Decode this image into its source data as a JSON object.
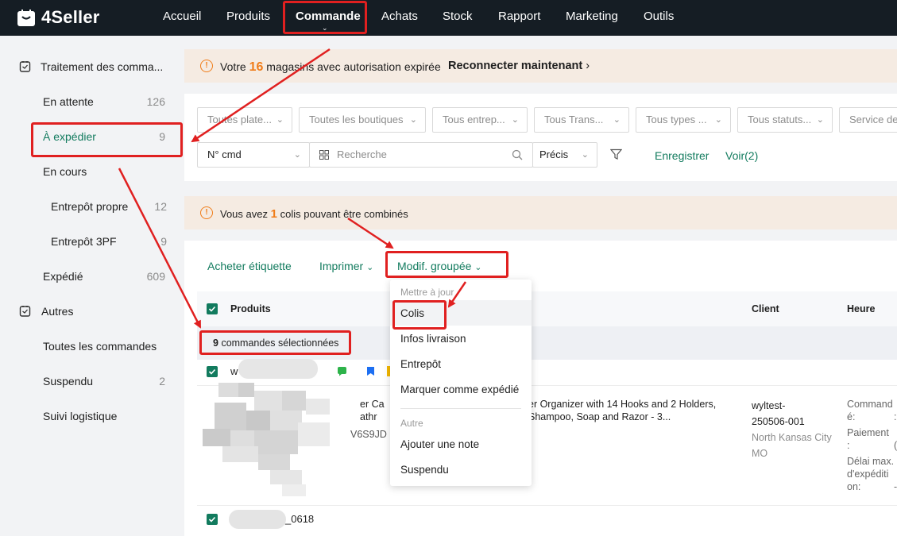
{
  "app": {
    "name": "4Seller"
  },
  "nav": {
    "items": [
      "Accueil",
      "Produits",
      "Commande",
      "Achats",
      "Stock",
      "Rapport",
      "Marketing",
      "Outils"
    ],
    "active": "Commande"
  },
  "sidebar": {
    "group1": "Traitement des comma...",
    "items": [
      {
        "label": "En attente",
        "count": "126"
      },
      {
        "label": "À expédier",
        "count": "9"
      },
      {
        "label": "En cours",
        "count": ""
      },
      {
        "label": "Entrepôt propre",
        "count": "12"
      },
      {
        "label": "Entrepôt 3PF",
        "count": "9"
      },
      {
        "label": "Expédié",
        "count": "609"
      }
    ],
    "group2": "Autres",
    "others": [
      {
        "label": "Toutes les commandes",
        "count": ""
      },
      {
        "label": "Suspendu",
        "count": "2"
      },
      {
        "label": "Suivi logistique",
        "count": ""
      }
    ]
  },
  "notice1": {
    "prefix": "Votre",
    "number": "16",
    "suffix": "magasins avec autorisation expirée",
    "action": "Reconnecter maintenant"
  },
  "filters": {
    "selects": [
      "Toutes plate...",
      "Toutes les boutiques",
      "Tous entrep...",
      "Tous Trans...",
      "Tous types ...",
      "Tous statuts...",
      "Service de"
    ],
    "search_type": "N° cmd",
    "search_placeholder": "Recherche",
    "match": "Précis",
    "save": "Enregistrer",
    "view": "Voir(2)"
  },
  "notice2": {
    "prefix": "Vous avez",
    "number": "1",
    "suffix": "colis pouvant être combinés"
  },
  "toolbar": {
    "buy_label": "Acheter étiquette",
    "print": "Imprimer",
    "bulk": "Modif. groupée"
  },
  "table": {
    "headers": {
      "products": "Produits",
      "client": "Client",
      "time": "Heure"
    },
    "selected_count": "9",
    "selected_text": "commandes sélectionnées",
    "order1": {
      "product_text_1": "er Ca",
      "product_text_2": "athr",
      "product_desc_1": "er Organizer with 14 Hooks and 2 Holders,",
      "product_desc_2": "Shampoo, Soap and Razor - 3...",
      "sku": "V6S9JD",
      "client_1": "wyltest-",
      "client_2": "250506-001",
      "city": "North Kansas City",
      "state": "MO",
      "time_labels": [
        "Command",
        "é:",
        "Paiement",
        ":",
        "Délai max.",
        "d'expéditi",
        "on:"
      ],
      "time_values": [
        ":",
        "(",
        "-"
      ]
    },
    "order2": {
      "id_suffix": "_0618"
    }
  },
  "dropdown": {
    "group1": "Mettre à jour",
    "items1": [
      "Colis",
      "Infos livraison",
      "Entrepôt",
      "Marquer comme expédié"
    ],
    "group2": "Autre",
    "items2": [
      "Ajouter une note",
      "Suspendu"
    ]
  },
  "colors": {
    "accent": "#127b5e",
    "warn": "#f07d1a",
    "annotation": "#e02020",
    "topbar": "#151d24"
  }
}
